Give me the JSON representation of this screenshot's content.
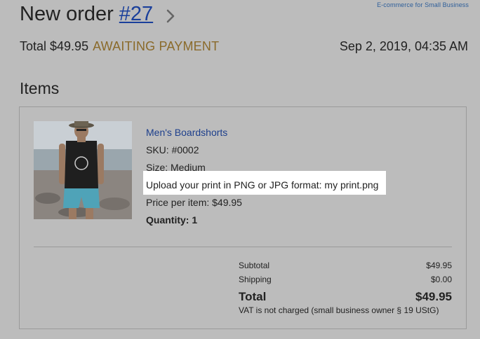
{
  "brand": "E-commerce for Small Business",
  "header": {
    "title_prefix": "New order",
    "order_number": "#27",
    "chevron_icon": "chevron-right-icon"
  },
  "meta": {
    "total_label": "Total $49.95",
    "status": "AWAITING PAYMENT",
    "date": "Sep 2, 2019, 04:35 AM"
  },
  "items": {
    "heading": "Items",
    "product": {
      "name": "Men's Boardshorts",
      "sku": "SKU: #0002",
      "size": "Size: Medium",
      "option": "Upload your print in PNG or JPG format: my print.png",
      "price": "Price per item: $49.95",
      "quantity": "Quantity: 1"
    }
  },
  "totals": {
    "subtotal_label": "Subtotal",
    "subtotal_value": "$49.95",
    "shipping_label": "Shipping",
    "shipping_value": "$0.00",
    "total_label": "Total",
    "total_value": "$49.95",
    "vat_note": "VAT is not charged (small business owner § 19 UStG)"
  },
  "colors": {
    "background": "#bcbcbc",
    "link": "#1a3f9b",
    "status": "#8a6a2a",
    "highlight": "#ffffff"
  }
}
